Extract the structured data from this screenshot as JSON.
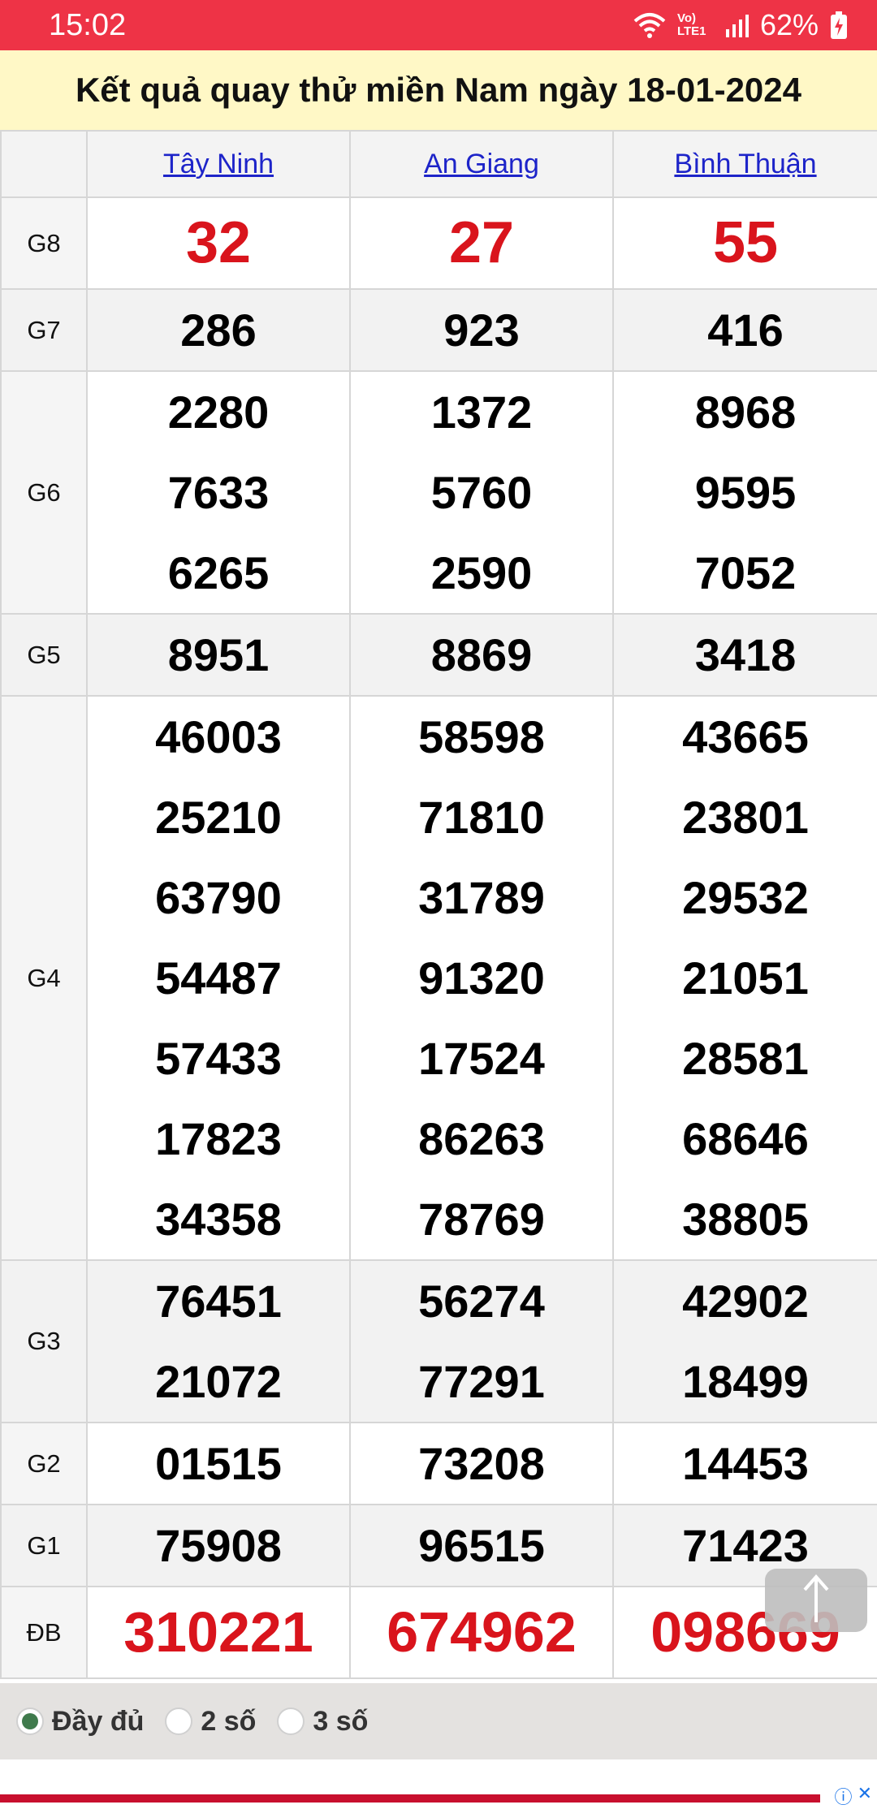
{
  "status_bar": {
    "time": "15:02",
    "network": "Vo) LTE1",
    "battery": "62%"
  },
  "page_title": "Kết quả quay thử miền Nam ngày 18-01-2024",
  "provinces": [
    "Tây Ninh",
    "An Giang",
    "Bình Thuận"
  ],
  "rows": [
    {
      "label": "G8",
      "type": "g8",
      "values": [
        [
          "32"
        ],
        [
          "27"
        ],
        [
          "55"
        ]
      ]
    },
    {
      "label": "G7",
      "type": "normal",
      "values": [
        [
          "286"
        ],
        [
          "923"
        ],
        [
          "416"
        ]
      ]
    },
    {
      "label": "G6",
      "type": "normal",
      "values": [
        [
          "2280",
          "7633",
          "6265"
        ],
        [
          "1372",
          "5760",
          "2590"
        ],
        [
          "8968",
          "9595",
          "7052"
        ]
      ]
    },
    {
      "label": "G5",
      "type": "normal",
      "values": [
        [
          "8951"
        ],
        [
          "8869"
        ],
        [
          "3418"
        ]
      ]
    },
    {
      "label": "G4",
      "type": "normal",
      "values": [
        [
          "46003",
          "25210",
          "63790",
          "54487",
          "57433",
          "17823",
          "34358"
        ],
        [
          "58598",
          "71810",
          "31789",
          "91320",
          "17524",
          "86263",
          "78769"
        ],
        [
          "43665",
          "23801",
          "29532",
          "21051",
          "28581",
          "68646",
          "38805"
        ]
      ]
    },
    {
      "label": "G3",
      "type": "normal",
      "values": [
        [
          "76451",
          "21072"
        ],
        [
          "56274",
          "77291"
        ],
        [
          "42902",
          "18499"
        ]
      ]
    },
    {
      "label": "G2",
      "type": "normal",
      "values": [
        [
          "01515"
        ],
        [
          "73208"
        ],
        [
          "14453"
        ]
      ]
    },
    {
      "label": "G1",
      "type": "normal",
      "values": [
        [
          "75908"
        ],
        [
          "96515"
        ],
        [
          "71423"
        ]
      ]
    },
    {
      "label": "ĐB",
      "type": "db",
      "values": [
        [
          "310221"
        ],
        [
          "674962"
        ],
        [
          "098669"
        ]
      ]
    }
  ],
  "filters": [
    {
      "label": "Đầy đủ",
      "selected": true
    },
    {
      "label": "2 số",
      "selected": false
    },
    {
      "label": "3 số",
      "selected": false
    }
  ],
  "colors": {
    "status_bar": "#ee3346",
    "title_band": "#fff8c6",
    "prize_red": "#d9141c",
    "link_blue": "#1d24c9"
  },
  "icons": {
    "scroll_top": "arrow-up-icon",
    "wifi": "wifi-calling-icon",
    "signal": "signal-icon",
    "battery": "battery-charging-icon"
  }
}
